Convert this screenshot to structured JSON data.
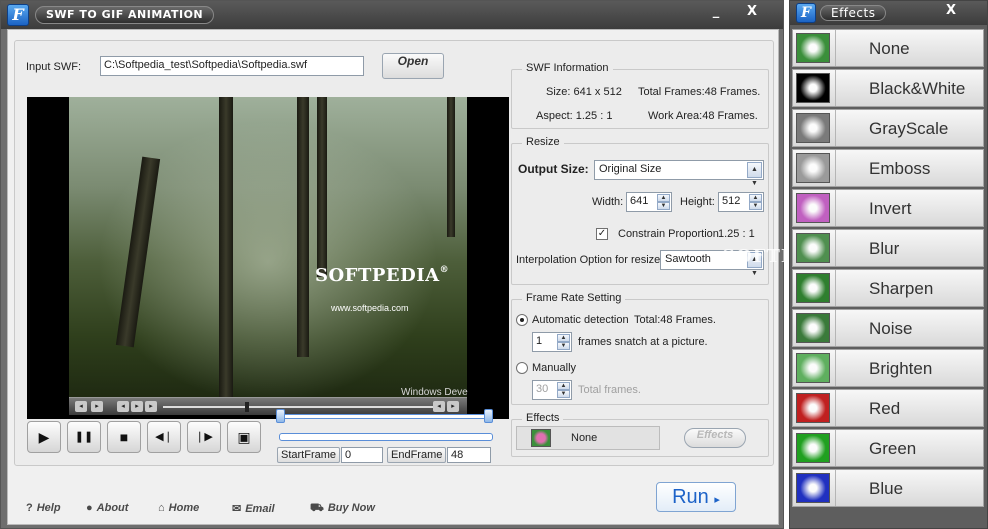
{
  "main_window": {
    "title": "SWF TO GIF ANIMATION",
    "minimize": "_",
    "close": "X"
  },
  "input": {
    "label": "Input SWF:",
    "value": "C:\\Softpedia_test\\Softpedia\\Softpedia.swf",
    "open_label": "Open"
  },
  "preview": {
    "logo_text": "SOFTPEDIA",
    "registered": "®",
    "url_text": "www.softpedia.com",
    "corner_text": "Windows Deve"
  },
  "controls": {
    "play_icon": "▶",
    "pause_icon": "❚❚",
    "stop_icon": "■",
    "prev_icon": "◀❘",
    "next_icon": "❘▶",
    "snapshot_icon": "▣"
  },
  "frames": {
    "start_label": "StartFrame",
    "start_value": "0",
    "end_label": "EndFrame",
    "end_value": "48"
  },
  "swf_info": {
    "title": "SWF Information",
    "size": "Size:  641 x 512",
    "total_frames": "Total Frames:48 Frames.",
    "aspect": "Aspect:  1.25 : 1",
    "work_area": "Work Area:48 Frames."
  },
  "resize": {
    "title": "Resize",
    "output_size_label": "Output Size:",
    "output_size_value": "Original Size",
    "width_label": "Width:",
    "width_value": "641",
    "height_label": "Height:",
    "height_value": "512",
    "constrain_label": "Constrain Proportion",
    "constrain_ratio": "1.25 : 1",
    "constrain_check": "✓",
    "interp_label": "Interpolation Option for resize:",
    "interp_value": "Sawtooth"
  },
  "frame_rate": {
    "title": "Frame Rate Setting",
    "auto_label": "Automatic detection",
    "auto_total": "Total:48 Frames.",
    "snatch_value": "1",
    "snatch_label": "frames snatch at a picture.",
    "manual_label": "Manually",
    "manual_value": "30",
    "manual_total_label": "Total frames."
  },
  "effects_group": {
    "title": "Effects",
    "current": "None",
    "button_label": "Effects"
  },
  "footer": {
    "help": "Help",
    "about": "About",
    "home": "Home",
    "email": "Email",
    "buy_now": "Buy Now",
    "run": "Run"
  },
  "watermark": "SOFTPEDIA",
  "effects_panel": {
    "title": "Effects",
    "close": "X",
    "items": [
      {
        "label": "None",
        "color": "#3b8f3b"
      },
      {
        "label": "Black&White",
        "color": "#000000"
      },
      {
        "label": "GrayScale",
        "color": "#7a7a7a"
      },
      {
        "label": "Emboss",
        "color": "#9a9a9a"
      },
      {
        "label": "Invert",
        "color": "#c060c0"
      },
      {
        "label": "Blur",
        "color": "#4f8f4f"
      },
      {
        "label": "Sharpen",
        "color": "#2f7f2f"
      },
      {
        "label": "Noise",
        "color": "#3a7a3a"
      },
      {
        "label": "Brighten",
        "color": "#5faf5f"
      },
      {
        "label": "Red",
        "color": "#c02020"
      },
      {
        "label": "Green",
        "color": "#20a020"
      },
      {
        "label": "Blue",
        "color": "#2030c0"
      }
    ]
  }
}
